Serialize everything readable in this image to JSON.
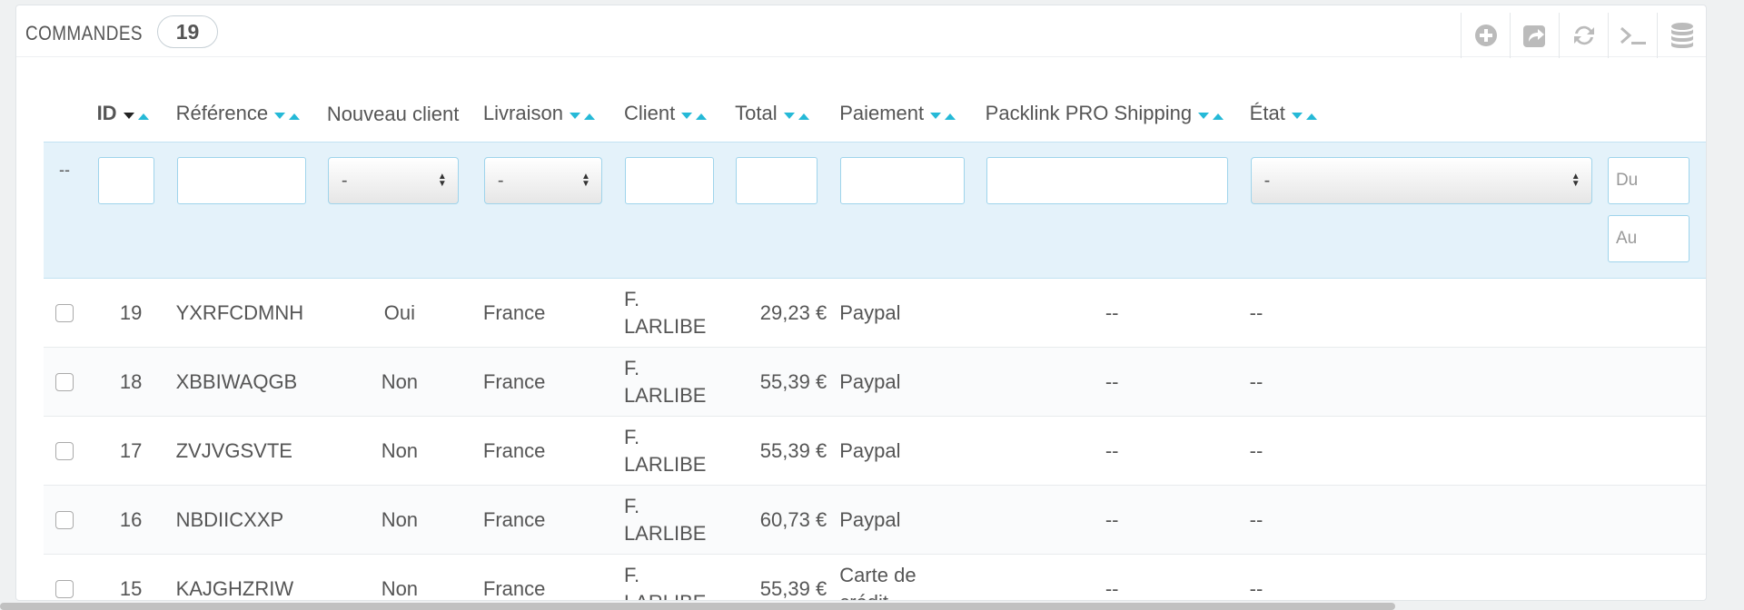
{
  "panel": {
    "title": "COMMANDES",
    "count": "19"
  },
  "toolbar": [
    {
      "name": "add-new-icon"
    },
    {
      "name": "export-icon"
    },
    {
      "name": "refresh-icon"
    },
    {
      "name": "sql-query-icon"
    },
    {
      "name": "database-icon"
    }
  ],
  "columns": {
    "id": "ID",
    "reference": "Référence",
    "new_client": "Nouveau client",
    "delivery": "Livraison",
    "client": "Client",
    "total": "Total",
    "payment": "Paiement",
    "packlink": "Packlink PRO Shipping",
    "state": "État"
  },
  "filters": {
    "placeholder_dash": "--",
    "new_client_select": "-",
    "delivery_select": "-",
    "state_select": "-",
    "date_from": "Du",
    "date_to": "Au"
  },
  "rows": [
    {
      "id": "19",
      "reference": "YXRFCDMNH",
      "new_client": "Oui",
      "delivery": "France",
      "client_line1": "F.",
      "client_line2": "LARLIBE",
      "total": "29,23 €",
      "payment_line1": "Paypal",
      "payment_line2": "",
      "packlink": "--",
      "state": "--"
    },
    {
      "id": "18",
      "reference": "XBBIWAQGB",
      "new_client": "Non",
      "delivery": "France",
      "client_line1": "F.",
      "client_line2": "LARLIBE",
      "total": "55,39 €",
      "payment_line1": "Paypal",
      "payment_line2": "",
      "packlink": "--",
      "state": "--"
    },
    {
      "id": "17",
      "reference": "ZVJVGSVTE",
      "new_client": "Non",
      "delivery": "France",
      "client_line1": "F.",
      "client_line2": "LARLIBE",
      "total": "55,39 €",
      "payment_line1": "Paypal",
      "payment_line2": "",
      "packlink": "--",
      "state": "--"
    },
    {
      "id": "16",
      "reference": "NBDIICXXP",
      "new_client": "Non",
      "delivery": "France",
      "client_line1": "F.",
      "client_line2": "LARLIBE",
      "total": "60,73 €",
      "payment_line1": "Paypal",
      "payment_line2": "",
      "packlink": "--",
      "state": "--"
    },
    {
      "id": "15",
      "reference": "KAJGHZRIW",
      "new_client": "Non",
      "delivery": "France",
      "client_line1": "F.",
      "client_line2": "LARLIBE",
      "total": "55,39 €",
      "payment_line1": "Carte de",
      "payment_line2": "crédit",
      "packlink": "--",
      "state": "--"
    }
  ],
  "colors": {
    "accent": "#25b9d7",
    "filter_bg": "#e4f2fa",
    "border": "#9fd4eb"
  }
}
